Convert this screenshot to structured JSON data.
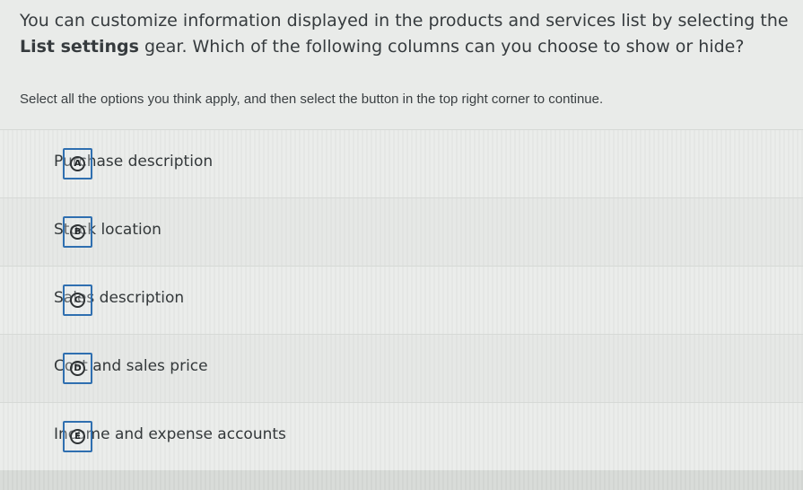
{
  "question": {
    "part1": "You can customize information displayed in the products and services list by selecting the ",
    "bold": "List settings",
    "part2": " gear. Which of the following columns can you choose to show or hide?"
  },
  "instructions": "Select all the options you think apply, and then select the button in the top right corner to continue.",
  "options": [
    {
      "letter": "A",
      "label": "Purchase description"
    },
    {
      "letter": "B",
      "label": "Stock location"
    },
    {
      "letter": "C",
      "label": "Sales description"
    },
    {
      "letter": "D",
      "label": "Cost and sales price"
    },
    {
      "letter": "E",
      "label": "Income and expense accounts"
    }
  ]
}
